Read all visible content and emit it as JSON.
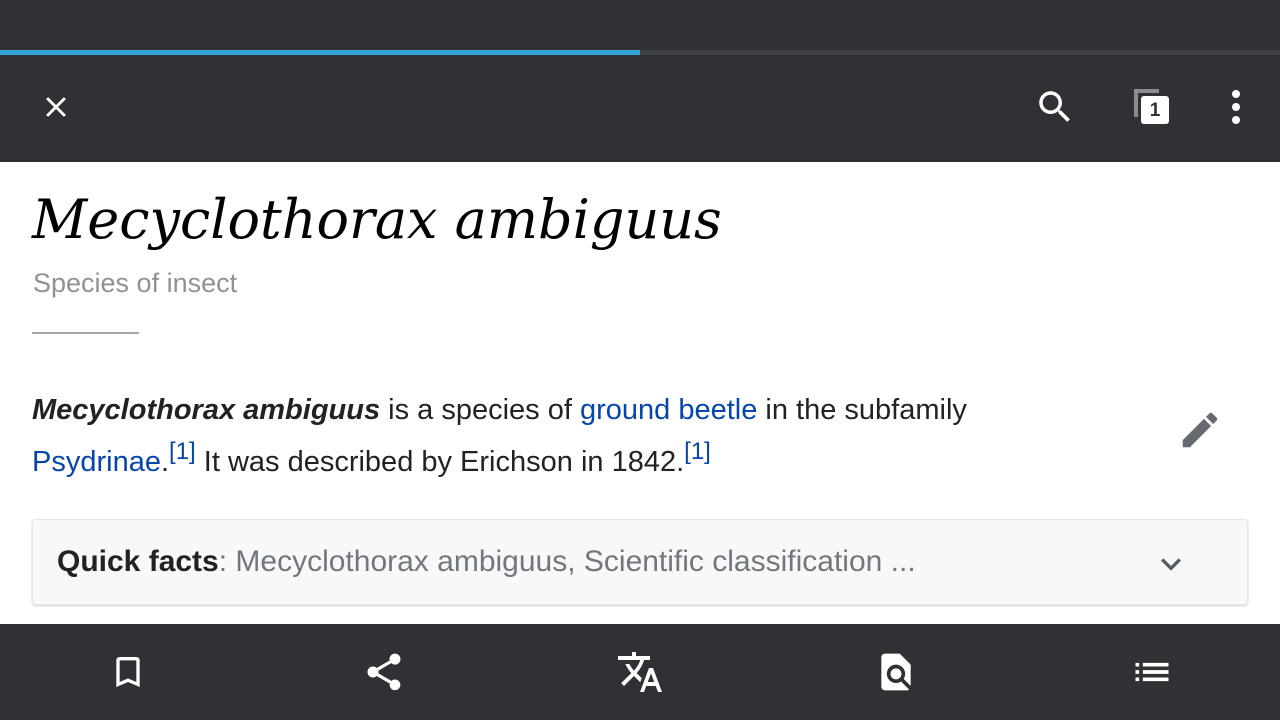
{
  "browser": {
    "load_progress_percent": 50,
    "tabs_count": "1",
    "progress_color": "#36a5d9",
    "toolbar_color": "#303134"
  },
  "toolbar": {
    "icons": [
      "close-icon",
      "search-icon",
      "tabs-icon",
      "overflow-menu-icon"
    ]
  },
  "article": {
    "title": "Mecyclothorax ambiguus",
    "description": "Species of insect",
    "lead": {
      "subject": "Mecyclothorax ambiguus",
      "text1": " is a species of ",
      "link1": "ground beetle",
      "text2": " in the subfamily ",
      "link2": "Psydrinae",
      "text3": ".",
      "ref1": "[1]",
      "text4": " It was described by Erichson in 1842.",
      "ref2": "[1]"
    },
    "link_color": "#0645ad",
    "edit_icon": "pencil-icon"
  },
  "quick_facts": {
    "label": "Quick facts",
    "separator": ": ",
    "summary": "Mecyclothorax ambiguus, Scientific classification ...",
    "expand_icon": "chevron-down-icon"
  },
  "bottom_bar": {
    "icons": [
      "bookmark-icon",
      "share-icon",
      "translate-icon",
      "find-in-page-icon",
      "contents-list-icon"
    ]
  }
}
